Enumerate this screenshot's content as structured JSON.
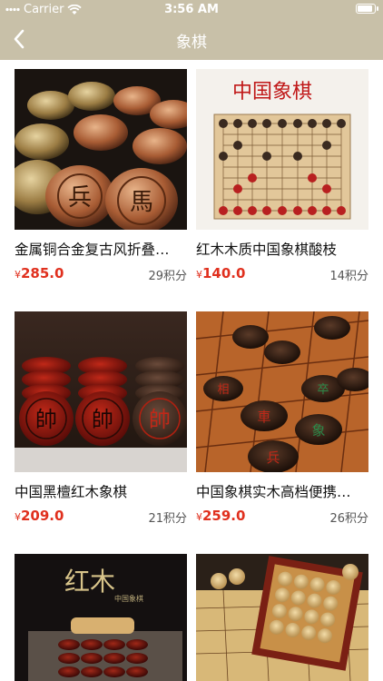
{
  "status_bar": {
    "carrier": "Carrier",
    "time": "3:56 AM"
  },
  "nav": {
    "title": "象棋"
  },
  "currency_symbol": "¥",
  "products": [
    {
      "name": "金属铜合金复古风折叠…",
      "price": "285.0",
      "points": "29积分"
    },
    {
      "name": "红木木质中国象棋酸枝",
      "price": "140.0",
      "points": "14积分"
    },
    {
      "name": "中国黑檀红木象棋",
      "price": "209.0",
      "points": "21积分"
    },
    {
      "name": "中国象棋实木高档便携…",
      "price": "259.0",
      "points": "26积分"
    },
    {
      "name": "",
      "price": "",
      "points": ""
    },
    {
      "name": "",
      "price": "",
      "points": ""
    }
  ],
  "image_text": {
    "p2_title": "中国象棋",
    "p5_title": "红木",
    "p5_sub": "中国象棋"
  },
  "colors": {
    "nav_bg": "#c8c0a8",
    "price": "#e0301e"
  }
}
